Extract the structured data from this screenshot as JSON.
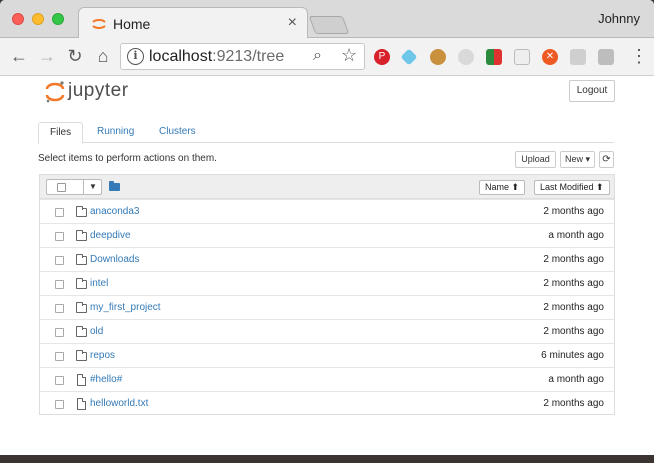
{
  "browser": {
    "tab_title": "Home",
    "tab_close": "×",
    "profile_name": "Johnny",
    "url_host": "localhost",
    "url_rest": ":9213/tree",
    "info_glyph": "i"
  },
  "header": {
    "logo_text": "jupyter",
    "logout_label": "Logout"
  },
  "tabs": [
    {
      "label": "Files"
    },
    {
      "label": "Running"
    },
    {
      "label": "Clusters"
    }
  ],
  "toolbar": {
    "hint": "Select items to perform actions on them.",
    "upload_label": "Upload",
    "new_label": "New ▾",
    "refresh_glyph": "⟳"
  },
  "listing": {
    "name_sort_label": "Name ⬆",
    "modified_sort_label": "Last Modified ⬆",
    "items": [
      {
        "name": "anaconda3",
        "type": "folder",
        "modified": "2 months ago"
      },
      {
        "name": "deepdive",
        "type": "folder",
        "modified": "a month ago"
      },
      {
        "name": "Downloads",
        "type": "folder",
        "modified": "2 months ago"
      },
      {
        "name": "intel",
        "type": "folder",
        "modified": "2 months ago"
      },
      {
        "name": "my_first_project",
        "type": "folder",
        "modified": "2 months ago"
      },
      {
        "name": "old",
        "type": "folder",
        "modified": "2 months ago"
      },
      {
        "name": "repos",
        "type": "folder",
        "modified": "6 minutes ago"
      },
      {
        "name": "#hello#",
        "type": "file",
        "modified": "a month ago"
      },
      {
        "name": "helloworld.txt",
        "type": "file",
        "modified": "2 months ago"
      }
    ]
  },
  "colors": {
    "accent": "#337ab7",
    "jupyter_orange": "#f37726"
  }
}
